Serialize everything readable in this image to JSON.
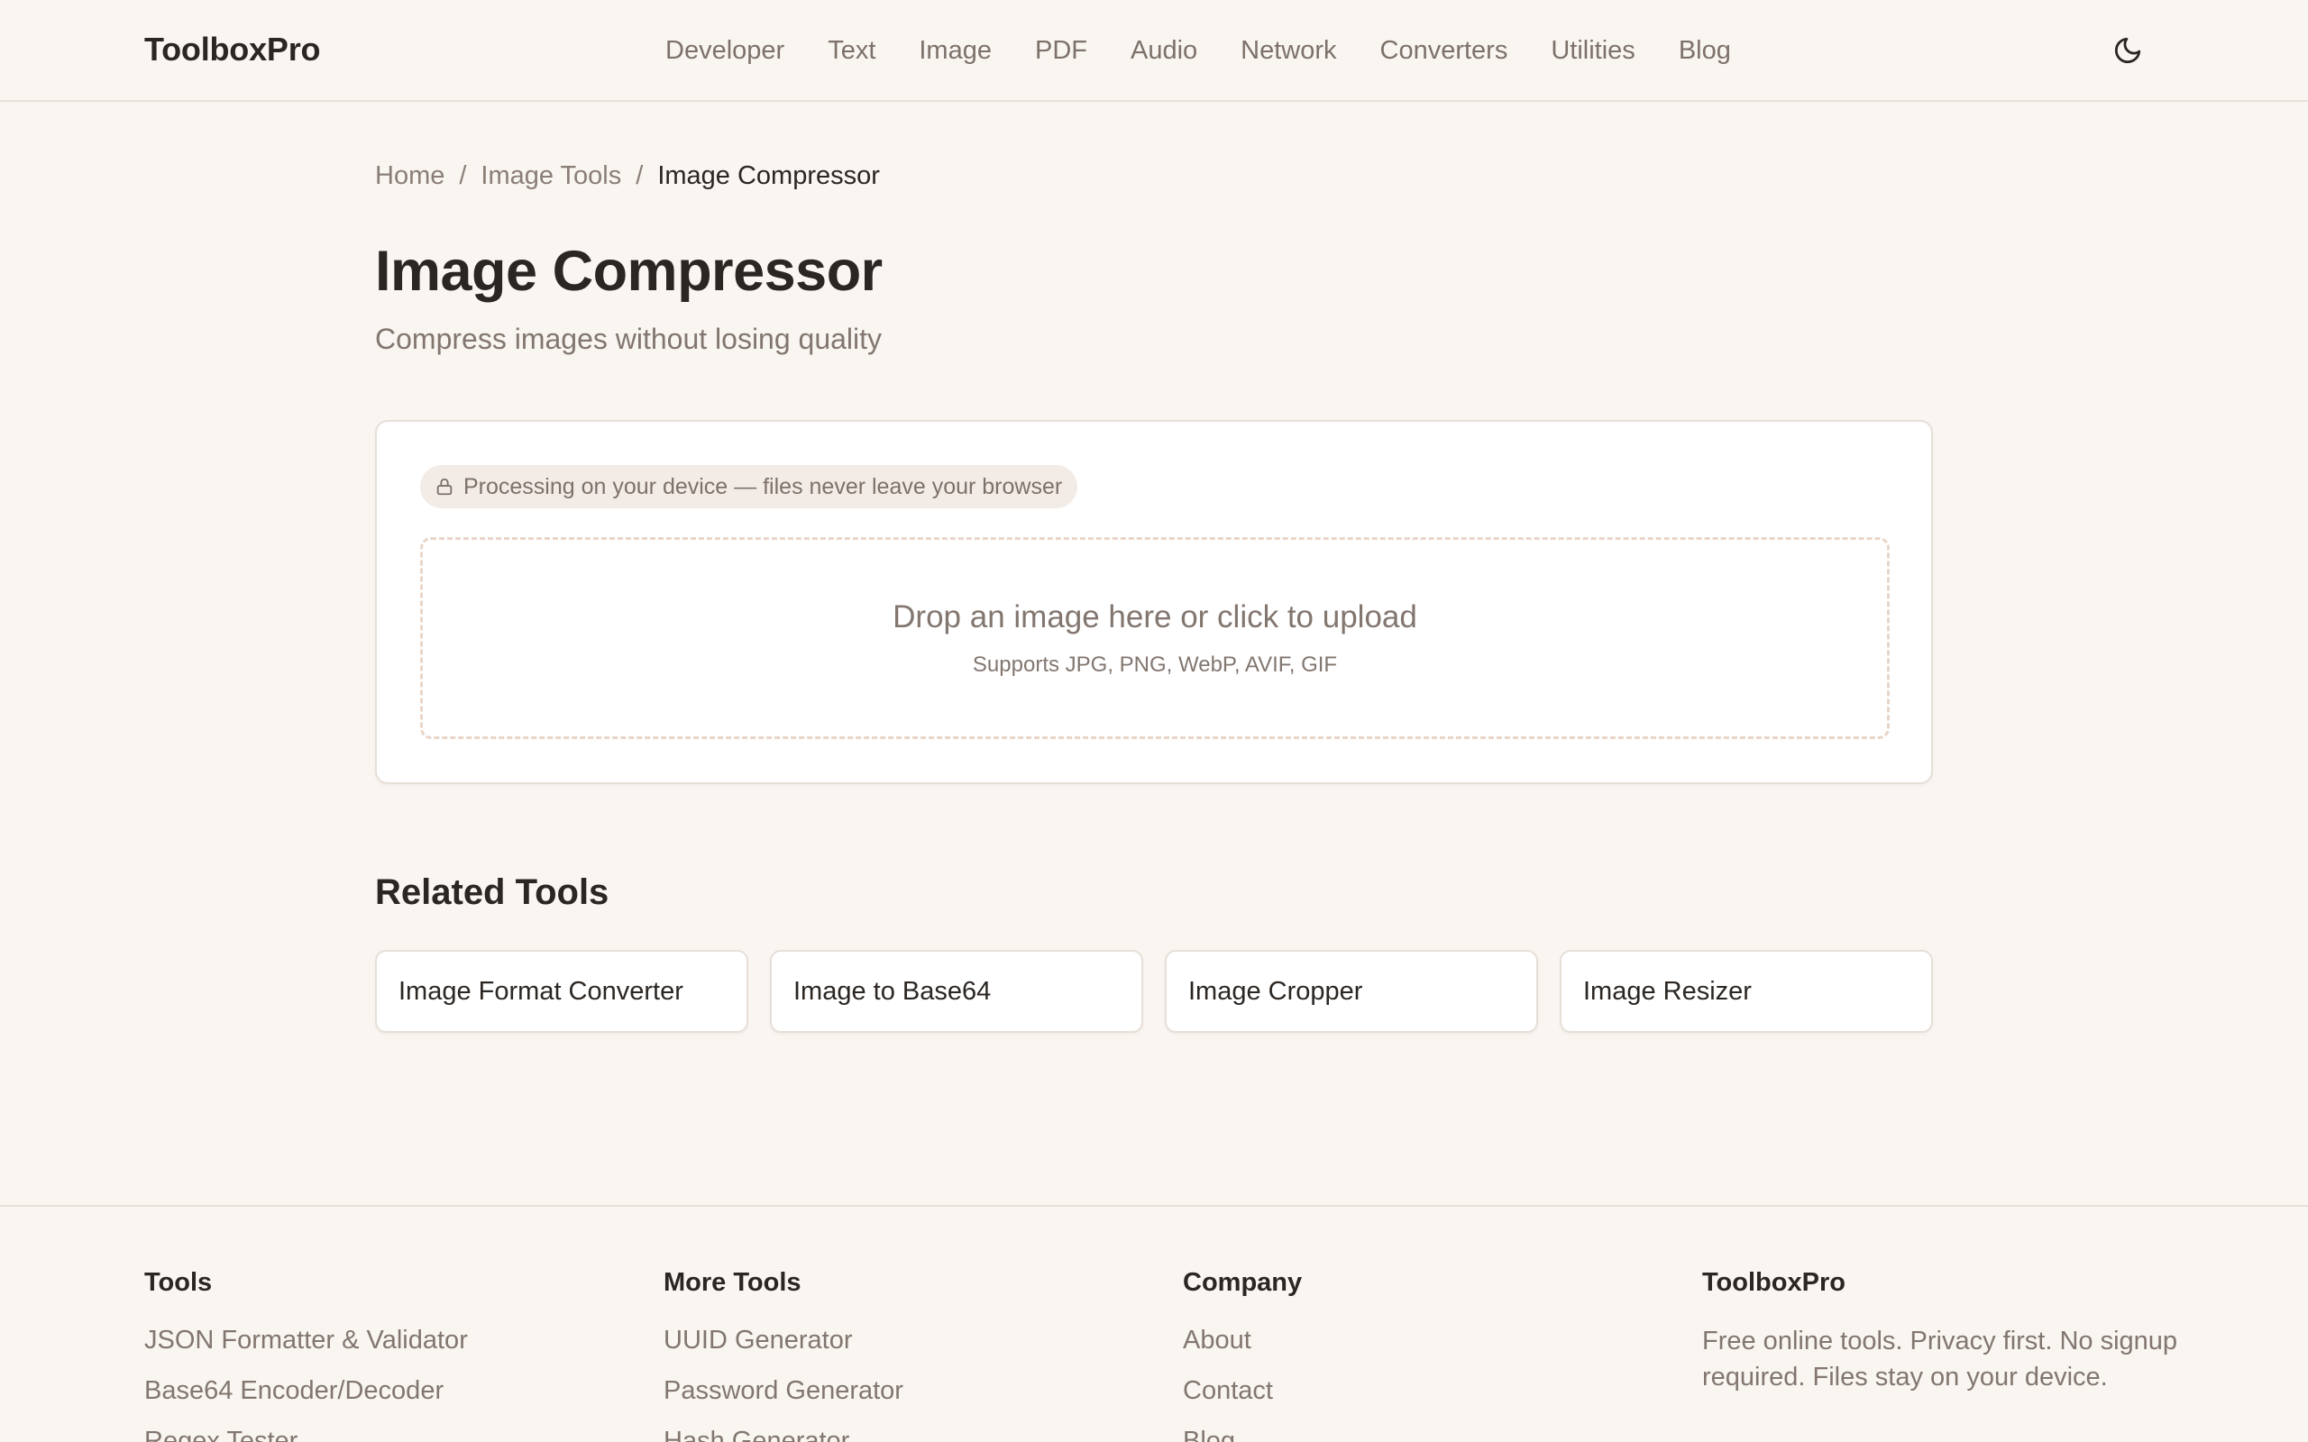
{
  "brand": "ToolboxPro",
  "nav": [
    "Developer",
    "Text",
    "Image",
    "PDF",
    "Audio",
    "Network",
    "Converters",
    "Utilities",
    "Blog"
  ],
  "icons": {
    "theme_toggle": "moon-icon",
    "privacy": "lock-icon"
  },
  "breadcrumb": {
    "home": "Home",
    "sep": "/",
    "category": "Image Tools",
    "current": "Image Compressor"
  },
  "page": {
    "title": "Image Compressor",
    "subtitle": "Compress images without losing quality"
  },
  "tool": {
    "privacy_badge": "Processing on your device — files never leave your browser",
    "drop_title": "Drop an image here or click to upload",
    "drop_sub": "Supports JPG, PNG, WebP, AVIF, GIF"
  },
  "related": {
    "title": "Related Tools",
    "items": [
      "Image Format Converter",
      "Image to Base64",
      "Image Cropper",
      "Image Resizer"
    ]
  },
  "footer": {
    "tools": {
      "title": "Tools",
      "links": [
        "JSON Formatter & Validator",
        "Base64 Encoder/Decoder",
        "Regex Tester"
      ]
    },
    "more_tools": {
      "title": "More Tools",
      "links": [
        "UUID Generator",
        "Password Generator",
        "Hash Generator"
      ]
    },
    "company": {
      "title": "Company",
      "links": [
        "About",
        "Contact",
        "Blog"
      ]
    },
    "brand": {
      "title": "ToolboxPro",
      "text": "Free online tools. Privacy first. No signup required. Files stay on your device."
    }
  },
  "colors": {
    "background": "#f9f5f1",
    "text": "#2b2622",
    "muted": "#82766f",
    "badge_bg": "#f3ece6",
    "dropzone_border": "#e7d6c9"
  }
}
